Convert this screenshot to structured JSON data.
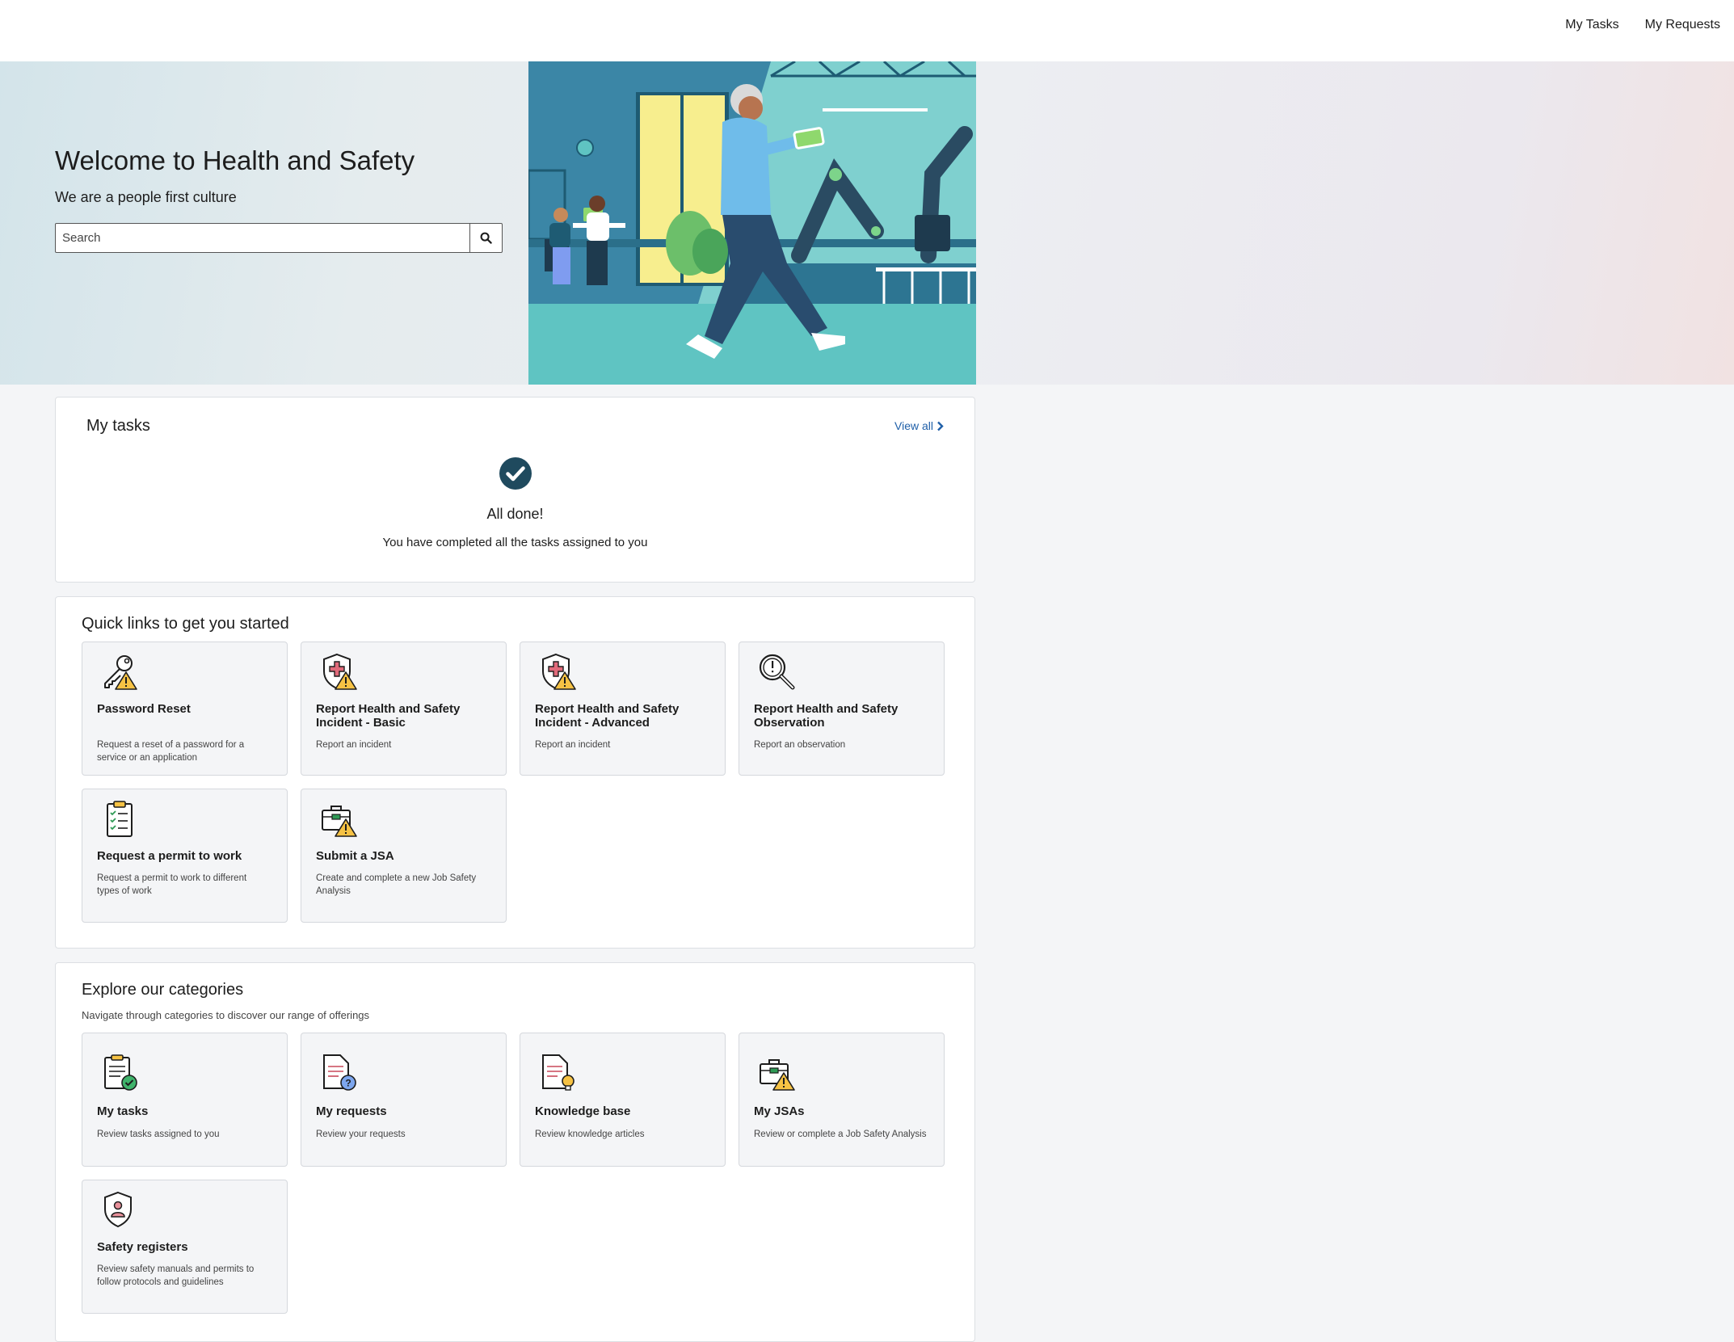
{
  "nav": {
    "my_tasks": "My Tasks",
    "my_requests": "My Requests"
  },
  "hero": {
    "title": "Welcome to Health and Safety",
    "subtitle": "We are a people first culture",
    "search_placeholder": "Search"
  },
  "tasks": {
    "title": "My tasks",
    "view_all": "View all",
    "done_title": "All done!",
    "done_text": "You have completed all the tasks assigned to you"
  },
  "quick_links": {
    "title": "Quick links to get you started",
    "items": [
      {
        "title": "Password Reset",
        "desc": "Request a reset of a password for a service or an application",
        "icon": "key-warning-icon"
      },
      {
        "title": "Report Health and Safety Incident - Basic",
        "desc": "Report an incident",
        "icon": "shield-warning-icon"
      },
      {
        "title": "Report Health and Safety Incident - Advanced",
        "desc": "Report an incident",
        "icon": "shield-warning-icon"
      },
      {
        "title": "Report Health and Safety Observation",
        "desc": "Report an observation",
        "icon": "magnifier-icon"
      },
      {
        "title": "Request a permit to work",
        "desc": "Request a permit to work to different types of work",
        "icon": "clipboard-checklist-icon"
      },
      {
        "title": "Submit a JSA",
        "desc": "Create and complete a new Job Safety Analysis",
        "icon": "toolbox-warning-icon"
      }
    ]
  },
  "categories": {
    "title": "Explore our categories",
    "subtitle": "Navigate through categories to discover our range of offerings",
    "items": [
      {
        "title": "My tasks",
        "desc": "Review tasks assigned to you",
        "icon": "clipboard-check-icon"
      },
      {
        "title": "My requests",
        "desc": "Review your requests",
        "icon": "document-question-icon"
      },
      {
        "title": "Knowledge base",
        "desc": "Review knowledge articles",
        "icon": "document-lightbulb-icon"
      },
      {
        "title": "My JSAs",
        "desc": "Review or complete a Job Safety Analysis",
        "icon": "toolbox-warning-icon"
      },
      {
        "title": "Safety registers",
        "desc": "Review safety manuals and permits to follow protocols and guidelines",
        "icon": "shield-person-icon"
      }
    ]
  },
  "colors": {
    "accent": "#1f5fa8",
    "check": "#1f4a5e",
    "warning": "#f6c244",
    "tile_bg": "#f4f5f7"
  }
}
